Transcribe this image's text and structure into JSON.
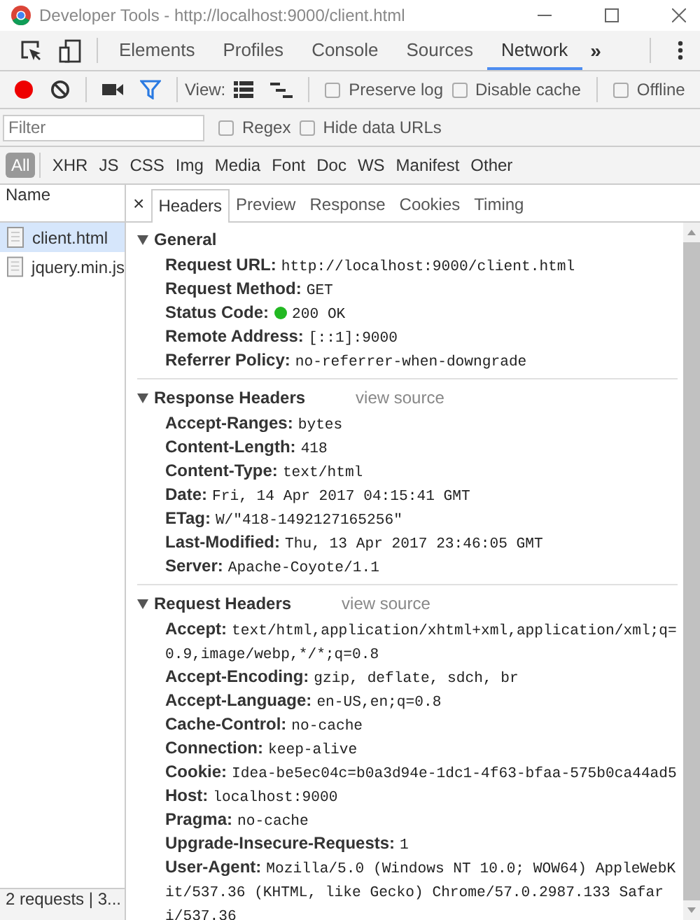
{
  "window": {
    "title": "Developer Tools - http://localhost:9000/client.html"
  },
  "main_tabs": [
    {
      "label": "Elements",
      "selected": false
    },
    {
      "label": "Profiles",
      "selected": false
    },
    {
      "label": "Console",
      "selected": false
    },
    {
      "label": "Sources",
      "selected": false
    },
    {
      "label": "Network",
      "selected": true
    }
  ],
  "more_tabs": "»",
  "toolbar": {
    "recording": true,
    "filter_on": true,
    "view_label": "View:",
    "options": [
      {
        "label": "Preserve log",
        "checked": false
      },
      {
        "label": "Disable cache",
        "checked": false
      },
      {
        "label": "Offline",
        "checked": false
      }
    ]
  },
  "filter": {
    "placeholder": "Filter",
    "options": [
      {
        "label": "Regex",
        "checked": false
      },
      {
        "label": "Hide data URLs",
        "checked": false
      }
    ]
  },
  "type_filters": [
    {
      "label": "All",
      "selected": true
    },
    {
      "label": "XHR",
      "selected": false
    },
    {
      "label": "JS",
      "selected": false
    },
    {
      "label": "CSS",
      "selected": false
    },
    {
      "label": "Img",
      "selected": false
    },
    {
      "label": "Media",
      "selected": false
    },
    {
      "label": "Font",
      "selected": false
    },
    {
      "label": "Doc",
      "selected": false
    },
    {
      "label": "WS",
      "selected": false
    },
    {
      "label": "Manifest",
      "selected": false
    },
    {
      "label": "Other",
      "selected": false
    }
  ],
  "requests": {
    "column": "Name",
    "items": [
      {
        "name": "client.html",
        "selected": true
      },
      {
        "name": "jquery.min.js",
        "selected": false
      }
    ],
    "status_bar": "2 requests | 3..."
  },
  "detail_close": "×",
  "detail_tabs": [
    {
      "label": "Headers",
      "selected": true
    },
    {
      "label": "Preview",
      "selected": false
    },
    {
      "label": "Response",
      "selected": false
    },
    {
      "label": "Cookies",
      "selected": false
    },
    {
      "label": "Timing",
      "selected": false
    }
  ],
  "sections": [
    {
      "title": "General",
      "expanded": true,
      "rows": [
        {
          "name": "Request URL:",
          "value": "http://localhost:9000/client.html"
        },
        {
          "name": "Request Method:",
          "value": "GET"
        },
        {
          "name": "Status Code:",
          "value": "200 OK",
          "color": "#22b822"
        },
        {
          "name": "Remote Address:",
          "value": "[::1]:9000"
        },
        {
          "name": "Referrer Policy:",
          "value": "no-referrer-when-downgrade"
        }
      ]
    },
    {
      "title": "Response Headers",
      "expanded": true,
      "link": "view source",
      "rows": [
        {
          "name": "Accept-Ranges:",
          "value": "bytes"
        },
        {
          "name": "Content-Length:",
          "value": "418"
        },
        {
          "name": "Content-Type:",
          "value": "text/html"
        },
        {
          "name": "Date:",
          "value": "Fri, 14 Apr 2017 04:15:41 GMT"
        },
        {
          "name": "ETag:",
          "value": "W/\"418-1492127165256\""
        },
        {
          "name": "Last-Modified:",
          "value": "Thu, 13 Apr 2017 23:46:05 GMT"
        },
        {
          "name": "Server:",
          "value": "Apache-Coyote/1.1"
        }
      ]
    },
    {
      "title": "Request Headers",
      "expanded": true,
      "link": "view source",
      "rows": [
        {
          "name": "Accept:",
          "value": "text/html,application/xhtml+xml,application/xml;q=0.9,image/webp,*/*;q=0.8"
        },
        {
          "name": "Accept-Encoding:",
          "value": "gzip, deflate, sdch, br"
        },
        {
          "name": "Accept-Language:",
          "value": "en-US,en;q=0.8"
        },
        {
          "name": "Cache-Control:",
          "value": "no-cache"
        },
        {
          "name": "Connection:",
          "value": "keep-alive"
        },
        {
          "name": "Cookie:",
          "value": "Idea-be5ec04c=b0a3d94e-1dc1-4f63-bfaa-575b0ca44ad5"
        },
        {
          "name": "Host:",
          "value": "localhost:9000"
        },
        {
          "name": "Pragma:",
          "value": "no-cache"
        },
        {
          "name": "Upgrade-Insecure-Requests:",
          "value": "1"
        },
        {
          "name": "User-Agent:",
          "value": "Mozilla/5.0 (Windows NT 10.0; WOW64) AppleWebKit/537.36 (KHTML, like Gecko) Chrome/57.0.2987.133 Safari/537.36"
        }
      ]
    }
  ]
}
